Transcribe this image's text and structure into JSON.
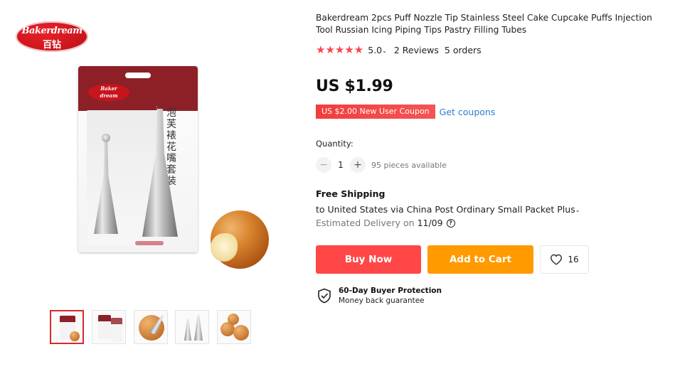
{
  "brand": {
    "logo_latin": "Bakerdream",
    "logo_cn": "百钻"
  },
  "product": {
    "title": "Bakerdream 2pcs Puff Nozzle Tip Stainless Steel Cake Cupcake Puffs Injection Tool Russian Icing Piping Tips Pastry Filling Tubes",
    "rating": {
      "stars": "★★★★★",
      "score": "5.0",
      "reviews": "2 Reviews",
      "orders": "5 orders"
    },
    "price": "US $1.99",
    "package_text_cn": "泡芙裱花嘴套装"
  },
  "coupon": {
    "label": "US $2.00 New User Coupon",
    "link": "Get coupons"
  },
  "quantity": {
    "label": "Quantity:",
    "minus": "−",
    "value": "1",
    "plus": "+",
    "available": "95 pieces available"
  },
  "shipping": {
    "title": "Free Shipping",
    "line": "to United States via China Post Ordinary Small Packet Plus",
    "delivery_label": "Estimated Delivery on",
    "delivery_date": "11/09"
  },
  "actions": {
    "buy_now": "Buy Now",
    "add_to_cart": "Add to Cart",
    "wishlist_count": "16"
  },
  "protection": {
    "title": "60-Day Buyer Protection",
    "subtitle": "Money back guarantee"
  },
  "gallery": {
    "thumbnail_count": 5,
    "active_index": 0
  },
  "colors": {
    "price_red": "#ff4747",
    "cart_orange": "#ff9a00",
    "star_red": "#f5464f",
    "link_blue": "#2e7dcf",
    "coupon_red": "#f23d3d"
  },
  "icons": [
    "heart-icon",
    "shield-check-icon",
    "question-icon",
    "chevron-down-icon"
  ]
}
